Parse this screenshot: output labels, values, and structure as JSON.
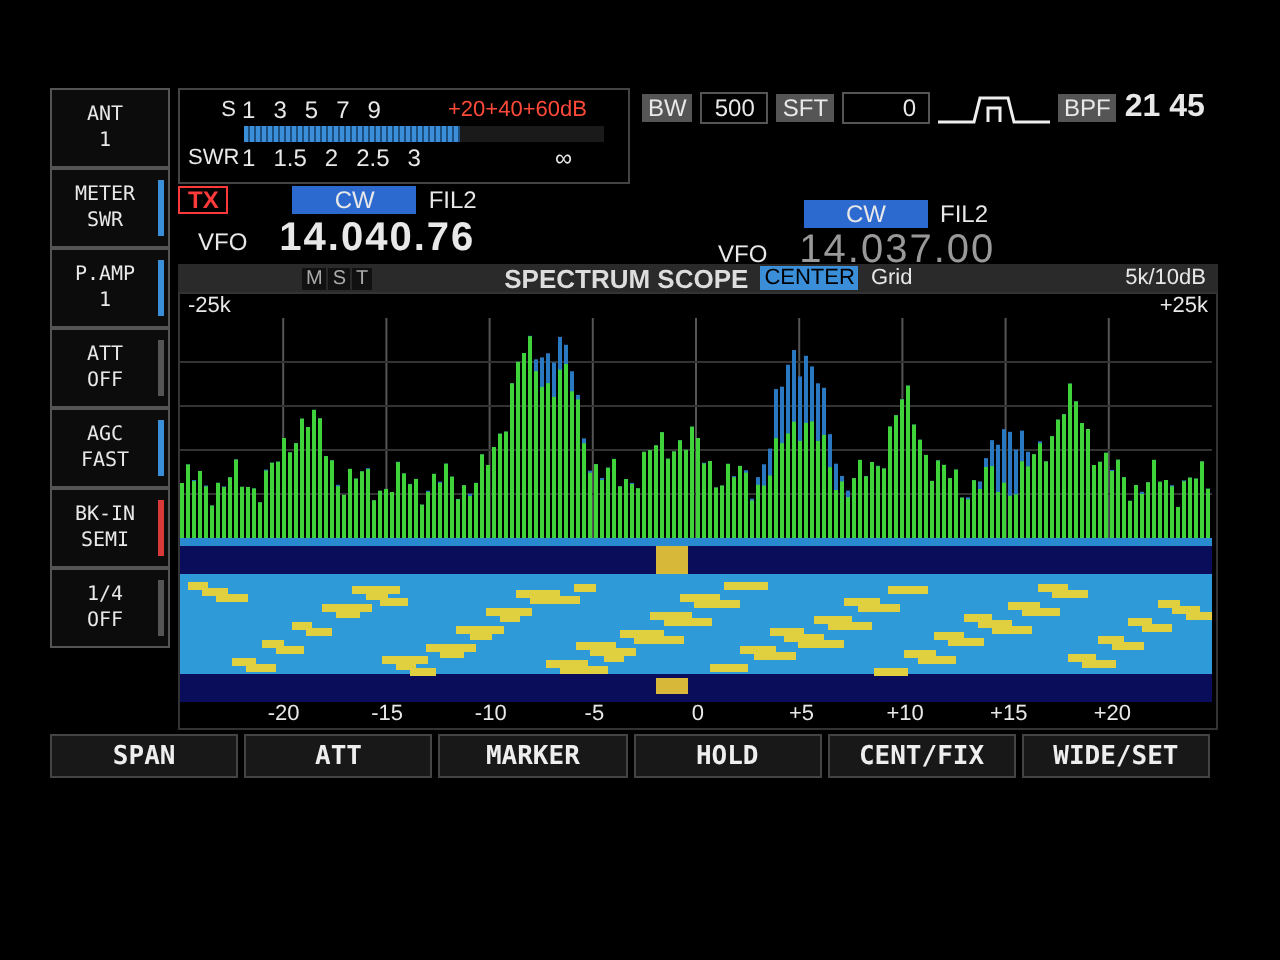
{
  "side_buttons": [
    {
      "label": "ANT",
      "value": "1"
    },
    {
      "label": "METER",
      "value": "SWR",
      "color": "#3a8fd8"
    },
    {
      "label": "P.AMP",
      "value": "1",
      "color": "#3a8fd8"
    },
    {
      "label": "ATT",
      "value": "OFF",
      "color": "#555555"
    },
    {
      "label": "AGC",
      "value": "FAST",
      "color": "#3a8fd8"
    },
    {
      "label": "BK-IN",
      "value": "SEMI",
      "color": "#d83a3a"
    },
    {
      "label": "1/4",
      "value": "OFF",
      "color": "#555555"
    }
  ],
  "meter": {
    "s_label": "S",
    "s_scale": [
      "1",
      "3",
      "5",
      "7",
      "9"
    ],
    "s_over": "+20+40+60dB",
    "swr_label": "SWR",
    "swr_scale": [
      "1",
      "1.5",
      "2",
      "2.5",
      "3"
    ],
    "swr_max": "∞",
    "level": 0.6
  },
  "top_bar": {
    "bw_label": "BW",
    "bw_value": "500",
    "sft_label": "SFT",
    "sft_value": "0",
    "bpf_label": "BPF",
    "clock": "21 45"
  },
  "vfo_main": {
    "tx": "TX",
    "mode": "CW",
    "filter": "FIL2",
    "label": "VFO",
    "frequency": "14.040.76"
  },
  "vfo_sub": {
    "mode": "CW",
    "filter": "FIL2",
    "label": "VFO",
    "frequency": "14.037.00"
  },
  "scope": {
    "mst": [
      "M",
      "S",
      "T"
    ],
    "title": "SPECTRUM SCOPE",
    "mode": "CENTER",
    "grid": "Grid",
    "scale": "5k/10dB",
    "left_edge": "-25k",
    "right_edge": "+25k",
    "ticks": [
      "-20",
      "-15",
      "-10",
      "-5",
      "0",
      "+5",
      "+10",
      "+15",
      "+20"
    ]
  },
  "soft_keys": [
    "SPAN",
    "ATT",
    "MARKER",
    "HOLD",
    "CENT/FIX",
    "WIDE/SET"
  ]
}
